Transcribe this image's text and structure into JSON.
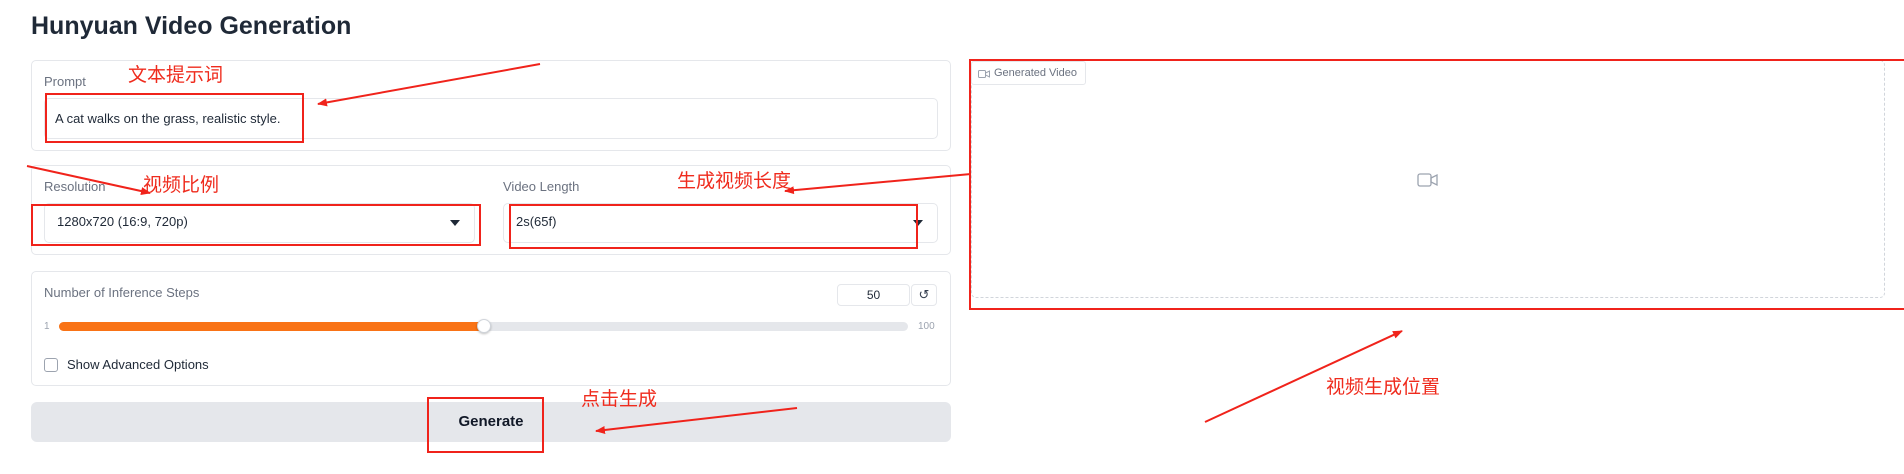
{
  "app": {
    "title": "Hunyuan Video Generation"
  },
  "prompt": {
    "label": "Prompt",
    "value": "A cat walks on the grass, realistic style."
  },
  "resolution": {
    "label": "Resolution",
    "value": "1280x720 (16:9, 720p)"
  },
  "video_length": {
    "label": "Video Length",
    "value": "2s(65f)"
  },
  "inference_steps": {
    "label": "Number of Inference Steps",
    "value": "50",
    "min": "1",
    "max": "100",
    "level": 0.5,
    "reset_icon": "↺"
  },
  "advanced": {
    "label": "Show Advanced Options",
    "checked": false
  },
  "generate": {
    "label": "Generate"
  },
  "output": {
    "label": "Generated Video",
    "icon": "video-camera-icon"
  },
  "annotations": {
    "prompt": "文本提示词",
    "resolution": "视频比例",
    "length": "生成视频长度",
    "generate": "点击生成",
    "output": "视频生成位置",
    "color": "#f0231b"
  }
}
